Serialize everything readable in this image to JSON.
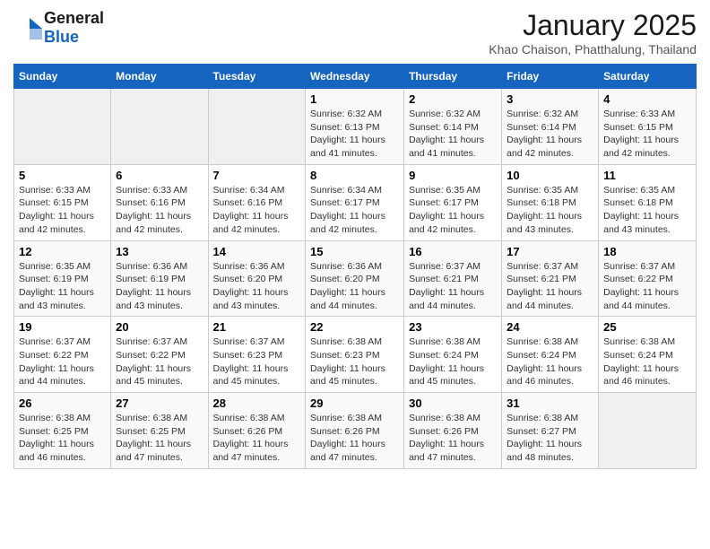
{
  "logo": {
    "general": "General",
    "blue": "Blue"
  },
  "title": {
    "month": "January 2025",
    "location": "Khao Chaison, Phatthalung, Thailand"
  },
  "weekdays": [
    "Sunday",
    "Monday",
    "Tuesday",
    "Wednesday",
    "Thursday",
    "Friday",
    "Saturday"
  ],
  "weeks": [
    [
      {
        "day": "",
        "sunrise": "",
        "sunset": "",
        "daylight": ""
      },
      {
        "day": "",
        "sunrise": "",
        "sunset": "",
        "daylight": ""
      },
      {
        "day": "",
        "sunrise": "",
        "sunset": "",
        "daylight": ""
      },
      {
        "day": "1",
        "sunrise": "Sunrise: 6:32 AM",
        "sunset": "Sunset: 6:13 PM",
        "daylight": "Daylight: 11 hours and 41 minutes."
      },
      {
        "day": "2",
        "sunrise": "Sunrise: 6:32 AM",
        "sunset": "Sunset: 6:14 PM",
        "daylight": "Daylight: 11 hours and 41 minutes."
      },
      {
        "day": "3",
        "sunrise": "Sunrise: 6:32 AM",
        "sunset": "Sunset: 6:14 PM",
        "daylight": "Daylight: 11 hours and 42 minutes."
      },
      {
        "day": "4",
        "sunrise": "Sunrise: 6:33 AM",
        "sunset": "Sunset: 6:15 PM",
        "daylight": "Daylight: 11 hours and 42 minutes."
      }
    ],
    [
      {
        "day": "5",
        "sunrise": "Sunrise: 6:33 AM",
        "sunset": "Sunset: 6:15 PM",
        "daylight": "Daylight: 11 hours and 42 minutes."
      },
      {
        "day": "6",
        "sunrise": "Sunrise: 6:33 AM",
        "sunset": "Sunset: 6:16 PM",
        "daylight": "Daylight: 11 hours and 42 minutes."
      },
      {
        "day": "7",
        "sunrise": "Sunrise: 6:34 AM",
        "sunset": "Sunset: 6:16 PM",
        "daylight": "Daylight: 11 hours and 42 minutes."
      },
      {
        "day": "8",
        "sunrise": "Sunrise: 6:34 AM",
        "sunset": "Sunset: 6:17 PM",
        "daylight": "Daylight: 11 hours and 42 minutes."
      },
      {
        "day": "9",
        "sunrise": "Sunrise: 6:35 AM",
        "sunset": "Sunset: 6:17 PM",
        "daylight": "Daylight: 11 hours and 42 minutes."
      },
      {
        "day": "10",
        "sunrise": "Sunrise: 6:35 AM",
        "sunset": "Sunset: 6:18 PM",
        "daylight": "Daylight: 11 hours and 43 minutes."
      },
      {
        "day": "11",
        "sunrise": "Sunrise: 6:35 AM",
        "sunset": "Sunset: 6:18 PM",
        "daylight": "Daylight: 11 hours and 43 minutes."
      }
    ],
    [
      {
        "day": "12",
        "sunrise": "Sunrise: 6:35 AM",
        "sunset": "Sunset: 6:19 PM",
        "daylight": "Daylight: 11 hours and 43 minutes."
      },
      {
        "day": "13",
        "sunrise": "Sunrise: 6:36 AM",
        "sunset": "Sunset: 6:19 PM",
        "daylight": "Daylight: 11 hours and 43 minutes."
      },
      {
        "day": "14",
        "sunrise": "Sunrise: 6:36 AM",
        "sunset": "Sunset: 6:20 PM",
        "daylight": "Daylight: 11 hours and 43 minutes."
      },
      {
        "day": "15",
        "sunrise": "Sunrise: 6:36 AM",
        "sunset": "Sunset: 6:20 PM",
        "daylight": "Daylight: 11 hours and 44 minutes."
      },
      {
        "day": "16",
        "sunrise": "Sunrise: 6:37 AM",
        "sunset": "Sunset: 6:21 PM",
        "daylight": "Daylight: 11 hours and 44 minutes."
      },
      {
        "day": "17",
        "sunrise": "Sunrise: 6:37 AM",
        "sunset": "Sunset: 6:21 PM",
        "daylight": "Daylight: 11 hours and 44 minutes."
      },
      {
        "day": "18",
        "sunrise": "Sunrise: 6:37 AM",
        "sunset": "Sunset: 6:22 PM",
        "daylight": "Daylight: 11 hours and 44 minutes."
      }
    ],
    [
      {
        "day": "19",
        "sunrise": "Sunrise: 6:37 AM",
        "sunset": "Sunset: 6:22 PM",
        "daylight": "Daylight: 11 hours and 44 minutes."
      },
      {
        "day": "20",
        "sunrise": "Sunrise: 6:37 AM",
        "sunset": "Sunset: 6:22 PM",
        "daylight": "Daylight: 11 hours and 45 minutes."
      },
      {
        "day": "21",
        "sunrise": "Sunrise: 6:37 AM",
        "sunset": "Sunset: 6:23 PM",
        "daylight": "Daylight: 11 hours and 45 minutes."
      },
      {
        "day": "22",
        "sunrise": "Sunrise: 6:38 AM",
        "sunset": "Sunset: 6:23 PM",
        "daylight": "Daylight: 11 hours and 45 minutes."
      },
      {
        "day": "23",
        "sunrise": "Sunrise: 6:38 AM",
        "sunset": "Sunset: 6:24 PM",
        "daylight": "Daylight: 11 hours and 45 minutes."
      },
      {
        "day": "24",
        "sunrise": "Sunrise: 6:38 AM",
        "sunset": "Sunset: 6:24 PM",
        "daylight": "Daylight: 11 hours and 46 minutes."
      },
      {
        "day": "25",
        "sunrise": "Sunrise: 6:38 AM",
        "sunset": "Sunset: 6:24 PM",
        "daylight": "Daylight: 11 hours and 46 minutes."
      }
    ],
    [
      {
        "day": "26",
        "sunrise": "Sunrise: 6:38 AM",
        "sunset": "Sunset: 6:25 PM",
        "daylight": "Daylight: 11 hours and 46 minutes."
      },
      {
        "day": "27",
        "sunrise": "Sunrise: 6:38 AM",
        "sunset": "Sunset: 6:25 PM",
        "daylight": "Daylight: 11 hours and 47 minutes."
      },
      {
        "day": "28",
        "sunrise": "Sunrise: 6:38 AM",
        "sunset": "Sunset: 6:26 PM",
        "daylight": "Daylight: 11 hours and 47 minutes."
      },
      {
        "day": "29",
        "sunrise": "Sunrise: 6:38 AM",
        "sunset": "Sunset: 6:26 PM",
        "daylight": "Daylight: 11 hours and 47 minutes."
      },
      {
        "day": "30",
        "sunrise": "Sunrise: 6:38 AM",
        "sunset": "Sunset: 6:26 PM",
        "daylight": "Daylight: 11 hours and 47 minutes."
      },
      {
        "day": "31",
        "sunrise": "Sunrise: 6:38 AM",
        "sunset": "Sunset: 6:27 PM",
        "daylight": "Daylight: 11 hours and 48 minutes."
      },
      {
        "day": "",
        "sunrise": "",
        "sunset": "",
        "daylight": ""
      }
    ]
  ]
}
